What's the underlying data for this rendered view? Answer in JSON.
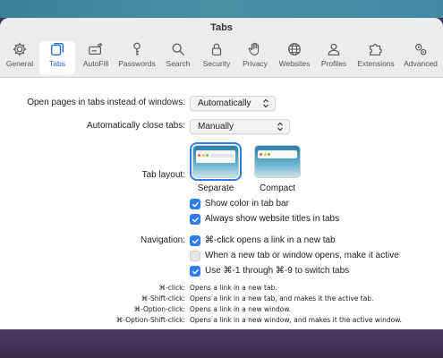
{
  "window": {
    "title": "Tabs"
  },
  "toolbar": {
    "tabs": [
      {
        "label": "General",
        "icon": "gear-icon"
      },
      {
        "label": "Tabs",
        "icon": "tabs-icon",
        "active": true
      },
      {
        "label": "AutoFill",
        "icon": "autofill-icon"
      },
      {
        "label": "Passwords",
        "icon": "key-icon"
      },
      {
        "label": "Search",
        "icon": "search-icon"
      },
      {
        "label": "Security",
        "icon": "lock-icon"
      },
      {
        "label": "Privacy",
        "icon": "hand-icon"
      },
      {
        "label": "Websites",
        "icon": "globe-icon"
      },
      {
        "label": "Profiles",
        "icon": "person-icon"
      },
      {
        "label": "Extensions",
        "icon": "puzzle-icon"
      },
      {
        "label": "Advanced",
        "icon": "gears-icon"
      }
    ]
  },
  "settings": {
    "open_pages": {
      "label": "Open pages in tabs instead of windows:",
      "value": "Automatically"
    },
    "auto_close": {
      "label": "Automatically close tabs:",
      "value": "Manually"
    },
    "tab_layout": {
      "label": "Tab layout:",
      "options": [
        {
          "label": "Separate",
          "selected": true
        },
        {
          "label": "Compact",
          "selected": false
        }
      ]
    },
    "layout_checks": [
      {
        "label": "Show color in tab bar",
        "checked": true
      },
      {
        "label": "Always show website titles in tabs",
        "checked": true
      }
    ],
    "navigation": {
      "label": "Navigation:",
      "checks": [
        {
          "label": "⌘-click opens a link in a new tab",
          "checked": true
        },
        {
          "label": "When a new tab or window opens, make it active",
          "checked": false
        },
        {
          "label": "Use ⌘-1 through ⌘-9 to switch tabs",
          "checked": true
        }
      ]
    },
    "shortcuts": [
      {
        "key": "⌘-click:",
        "desc": "Opens a link in a new tab."
      },
      {
        "key": "⌘-Shift-click:",
        "desc": "Opens a link in a new tab, and makes it the active tab."
      },
      {
        "key": "⌘-Option-click:",
        "desc": "Opens a link in a new window."
      },
      {
        "key": "⌘-Option-Shift-click:",
        "desc": "Opens a link in a new window, and makes it the active window."
      }
    ]
  },
  "colors": {
    "accent": "#2d7cf0",
    "active_tab_label": "#1e6fd9"
  }
}
